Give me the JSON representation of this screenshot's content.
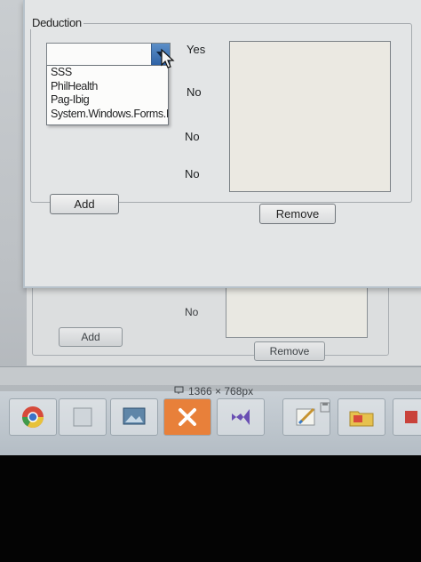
{
  "background_window": {
    "label_top": "No",
    "label_no": "No",
    "add_label": "Add",
    "remove_label": "Remove"
  },
  "dialog": {
    "group_title": "Deduction",
    "combo": {
      "value": "",
      "options": [
        "SSS",
        "PhilHealth",
        "Pag-Ibig",
        "System.Windows.Forms.I"
      ]
    },
    "row_labels": [
      "Yes",
      "No",
      "No",
      "No"
    ],
    "add_label": "Add",
    "remove_label": "Remove"
  },
  "status": {
    "resolution": "1366 × 768px"
  },
  "icons": {
    "combo_arrow": "chevron-down-icon",
    "cursor": "mouse-pointer-icon",
    "resolution": "screen-size-icon",
    "save": "save-icon",
    "taskbar": [
      "chrome-icon",
      "blank-app-icon",
      "image-viewer-icon",
      "xampp-icon",
      "visual-studio-icon",
      "paint-icon",
      "folder-icon",
      "app-icon"
    ]
  },
  "colors": {
    "accent": "#2f63a6",
    "dialog_bg": "#e3e5e6",
    "listbox_bg": "#ebe9e2"
  }
}
